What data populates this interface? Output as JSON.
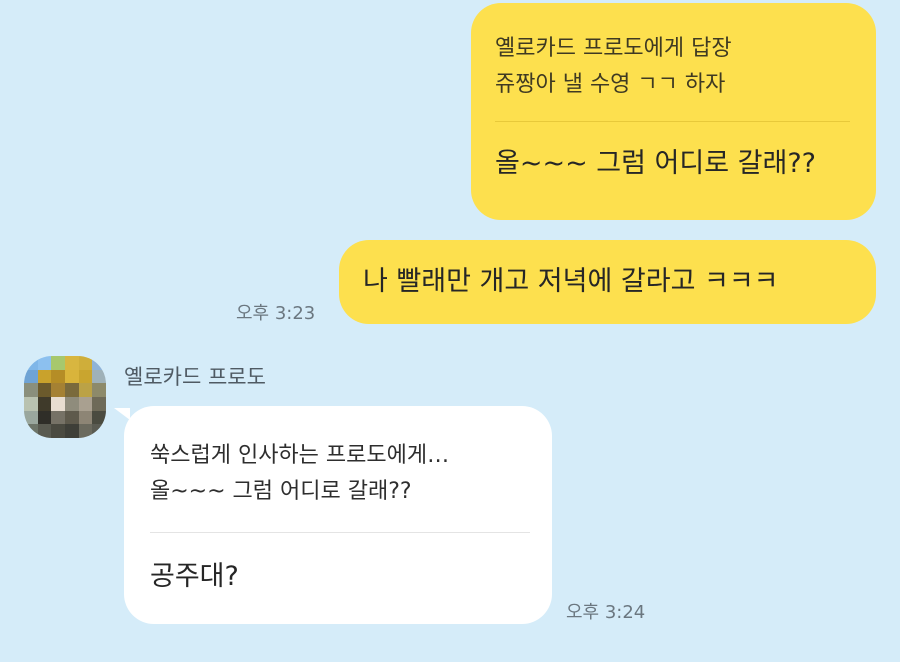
{
  "messages": {
    "reply": {
      "quote_header": "옐로카드 프로도에게 답장",
      "quote_text": "쥬짱아 낼 수영 ㄱㄱ 하자",
      "text": "올~~~ 그럼 어디로 갈래??"
    },
    "mine_2": {
      "text": "나 빨래만 개고 저녁에 갈라고 ㅋㅋㅋ",
      "time": "오후 3:23"
    },
    "theirs": {
      "sender": "옐로카드 프로도",
      "quote_header": "쑥스럽게 인사하는 프로도에게…",
      "quote_text": "올~~~ 그럼 어디로 갈래??",
      "text": "공주대?",
      "time": "오후 3:24"
    }
  },
  "colors": {
    "background": "#d5ecf9",
    "my_bubble": "#fde04e",
    "their_bubble": "#ffffff"
  }
}
